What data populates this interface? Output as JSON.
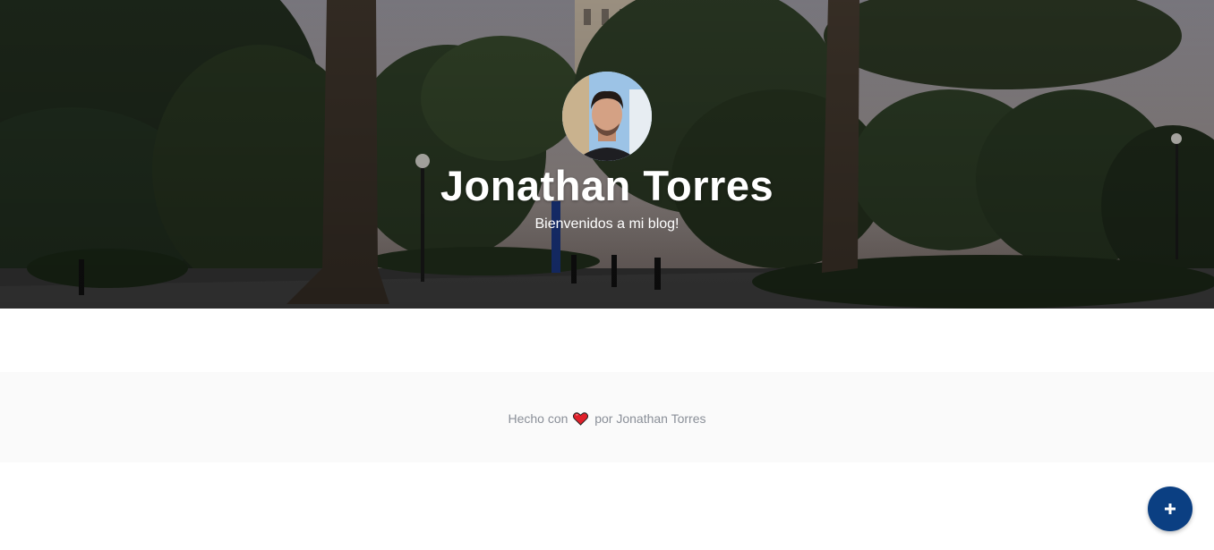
{
  "hero": {
    "title": "Jonathan Torres",
    "subtitle": "Bienvenidos a mi blog!",
    "avatar_alt": "Jonathan Torres"
  },
  "footer": {
    "prefix": "Hecho con",
    "icon": "heart-icon",
    "suffix": "por Jonathan Torres"
  },
  "fab": {
    "label": "+",
    "icon": "plus-icon"
  },
  "colors": {
    "fab_background": "#0b3f82",
    "footer_background": "#fafafa",
    "footer_text": "#8a8f98",
    "heart": "#e0202a"
  }
}
